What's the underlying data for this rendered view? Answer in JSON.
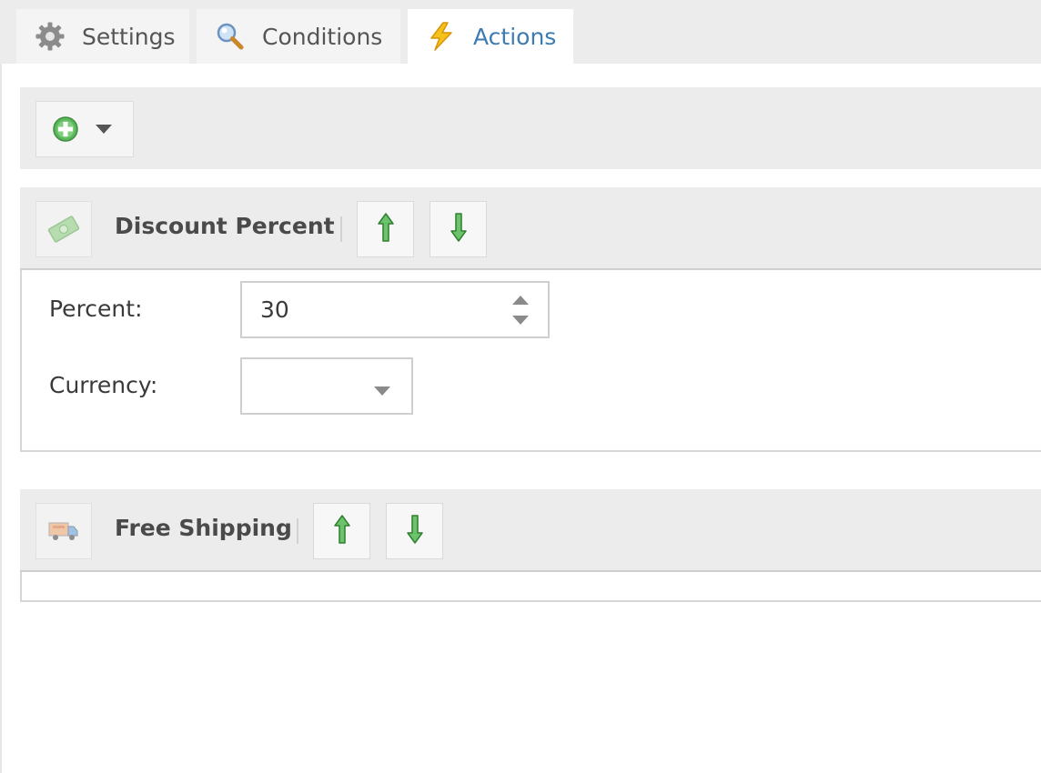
{
  "tabs": [
    {
      "label": "Settings",
      "icon": "gear-icon",
      "active": false
    },
    {
      "label": "Conditions",
      "icon": "magnifier-icon",
      "active": false
    },
    {
      "label": "Actions",
      "icon": "lightning-icon",
      "active": true
    }
  ],
  "toolbar": {
    "add_icon": "plus-circle-icon",
    "dropdown_icon": "caret-down-icon"
  },
  "actions": [
    {
      "title": "Discount Percent",
      "icon": "banknote-icon",
      "fields": {
        "percent_label": "Percent:",
        "percent_value": "30",
        "currency_label": "Currency:",
        "currency_value": ""
      }
    },
    {
      "title": "Free Shipping",
      "icon": "truck-icon"
    }
  ],
  "colors": {
    "active_tab_text": "#3d7bb3",
    "arrow_green": "#3a9a3a",
    "add_green": "#4caf50"
  }
}
